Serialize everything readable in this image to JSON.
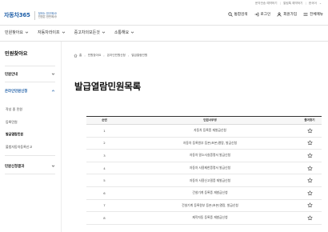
{
  "util_links": [
    "문자전송 예약하기",
    "알림톡 예약하기",
    "한국어"
  ],
  "logo": {
    "name": "자동차365",
    "slogan_line1": "정보는 한곳에서!",
    "slogan_line2": "민원은 한번에서!"
  },
  "header_actions": {
    "search": "통합검색",
    "login": "로그인",
    "signup": "회원가입",
    "menu": "전체메뉴"
  },
  "gnb": [
    "민원찾아요",
    "자동차라이프",
    "중고차의모든것",
    "소통해요"
  ],
  "sidebar": {
    "title": "민원찾아요",
    "sections": [
      {
        "label": "민원안내"
      },
      {
        "label": "온라인민원신청"
      },
      {
        "label": "민원신청결과"
      }
    ],
    "subitems": [
      "작성 중 민원",
      "등록민원",
      "발급열람민원",
      "불법자동차등록신고"
    ]
  },
  "breadcrumb": {
    "home": "홈",
    "items": [
      "민원찾아요",
      "온라인민원신청",
      "발급열람민원"
    ]
  },
  "page_title": "발급열람민원목록",
  "table": {
    "headers": {
      "no": "순번",
      "name": "민원사무명",
      "fav": "즐겨찾기"
    },
    "rows": [
      {
        "no": "1",
        "name": "자동차 등록증 재발급신청"
      },
      {
        "no": "2",
        "name": "자동차 등록원부 등본(초본)열람, 발급신청"
      },
      {
        "no": "3",
        "name": "자동차 말소사실증명서 발급신청"
      },
      {
        "no": "4",
        "name": "자동차 사용제한증명서 발급신청"
      },
      {
        "no": "5",
        "name": "자동차 사용신고필증 재발급신청"
      },
      {
        "no": "6",
        "name": "건설기계 등록증 재발급신청"
      },
      {
        "no": "7",
        "name": "건설기계 등록원부 등본(초본)열람, 발급신청"
      },
      {
        "no": "8",
        "name": "제작자동 등록증 재발급신청"
      }
    ]
  },
  "colors": {
    "brand": "#1f5fa8",
    "text": "#222222",
    "line": "#e3e3e3"
  }
}
